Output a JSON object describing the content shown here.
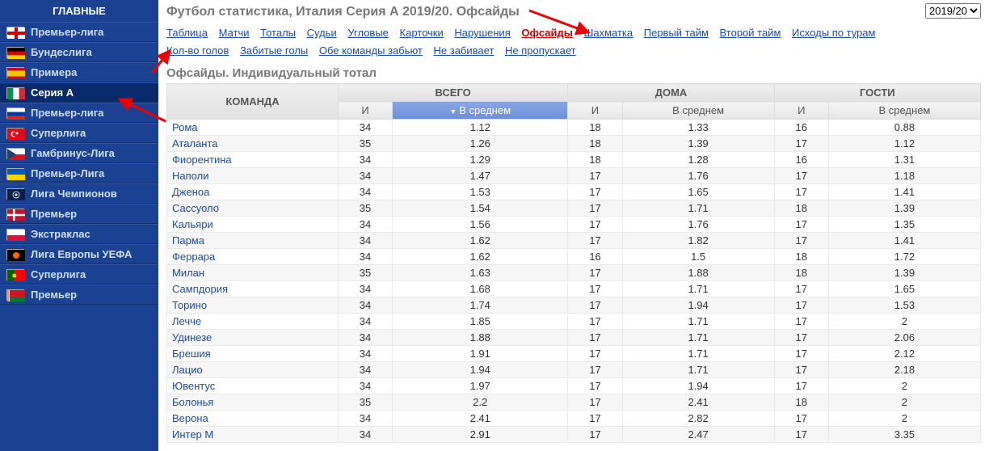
{
  "sidebar": {
    "header": "ГЛАВНЫЕ",
    "items": [
      {
        "label": "Премьер-лига",
        "flag": "england"
      },
      {
        "label": "Бундеслига",
        "flag": "germany"
      },
      {
        "label": "Примера",
        "flag": "spain"
      },
      {
        "label": "Серия А",
        "flag": "italy",
        "active": true
      },
      {
        "label": "Премьер-лига",
        "flag": "russia"
      },
      {
        "label": "Суперлига",
        "flag": "turkey"
      },
      {
        "label": "Гамбринус-Лига",
        "flag": "czech"
      },
      {
        "label": "Премьер-Лига",
        "flag": "ukraine"
      },
      {
        "label": "Лига Чемпионов",
        "flag": "uefa-cl"
      },
      {
        "label": "Премьер",
        "flag": "denmark"
      },
      {
        "label": "Экстраклас",
        "flag": "poland"
      },
      {
        "label": "Лига Европы УЕФА",
        "flag": "uefa-el"
      },
      {
        "label": "Суперлига",
        "flag": "portugal"
      },
      {
        "label": "Премьер",
        "flag": "belarus"
      }
    ]
  },
  "page_title": "Футбол статистика, Италия Серия А 2019/20. Офсайды",
  "season": "2019/20",
  "tabs_row1": [
    {
      "label": "Таблица"
    },
    {
      "label": "Матчи"
    },
    {
      "label": "Тоталы"
    },
    {
      "label": "Судьи"
    },
    {
      "label": "Угловые"
    },
    {
      "label": "Карточки"
    },
    {
      "label": "Нарушения"
    },
    {
      "label": "Офсайды",
      "active": true
    },
    {
      "label": "Шахматка"
    },
    {
      "label": "Первый тайм"
    },
    {
      "label": "Второй тайм"
    },
    {
      "label": "Исходы по турам"
    }
  ],
  "tabs_row2": [
    {
      "label": "Кол-во голов"
    },
    {
      "label": "Забитые голы"
    },
    {
      "label": "Обе команды забьют"
    },
    {
      "label": "Не забивает"
    },
    {
      "label": "Не пропускает"
    }
  ],
  "section_title": "Офсайды. Индивидуальный тотал",
  "table": {
    "group_headers": [
      "КОМАНДА",
      "ВСЕГО",
      "ДОМА",
      "ГОСТИ"
    ],
    "sub_headers": [
      "И",
      "В среднем",
      "И",
      "В среднем",
      "И",
      "В среднем"
    ],
    "sorted_col_label": "В среднем",
    "rows": [
      {
        "team": "Рома",
        "vals": [
          "34",
          "1.12",
          "18",
          "1.33",
          "16",
          "0.88"
        ]
      },
      {
        "team": "Аталанта",
        "vals": [
          "35",
          "1.26",
          "18",
          "1.39",
          "17",
          "1.12"
        ]
      },
      {
        "team": "Фиорентина",
        "vals": [
          "34",
          "1.29",
          "18",
          "1.28",
          "16",
          "1.31"
        ]
      },
      {
        "team": "Наполи",
        "vals": [
          "34",
          "1.47",
          "17",
          "1.76",
          "17",
          "1.18"
        ]
      },
      {
        "team": "Дженоа",
        "vals": [
          "34",
          "1.53",
          "17",
          "1.65",
          "17",
          "1.41"
        ]
      },
      {
        "team": "Сассуоло",
        "vals": [
          "35",
          "1.54",
          "17",
          "1.71",
          "18",
          "1.39"
        ]
      },
      {
        "team": "Кальяри",
        "vals": [
          "34",
          "1.56",
          "17",
          "1.76",
          "17",
          "1.35"
        ]
      },
      {
        "team": "Парма",
        "vals": [
          "34",
          "1.62",
          "17",
          "1.82",
          "17",
          "1.41"
        ]
      },
      {
        "team": "Феррара",
        "vals": [
          "34",
          "1.62",
          "16",
          "1.5",
          "18",
          "1.72"
        ]
      },
      {
        "team": "Милан",
        "vals": [
          "35",
          "1.63",
          "17",
          "1.88",
          "18",
          "1.39"
        ]
      },
      {
        "team": "Сампдория",
        "vals": [
          "34",
          "1.68",
          "17",
          "1.71",
          "17",
          "1.65"
        ]
      },
      {
        "team": "Торино",
        "vals": [
          "34",
          "1.74",
          "17",
          "1.94",
          "17",
          "1.53"
        ]
      },
      {
        "team": "Лечче",
        "vals": [
          "34",
          "1.85",
          "17",
          "1.71",
          "17",
          "2"
        ]
      },
      {
        "team": "Удинезе",
        "vals": [
          "34",
          "1.88",
          "17",
          "1.71",
          "17",
          "2.06"
        ]
      },
      {
        "team": "Брешия",
        "vals": [
          "34",
          "1.91",
          "17",
          "1.71",
          "17",
          "2.12"
        ]
      },
      {
        "team": "Лацио",
        "vals": [
          "34",
          "1.94",
          "17",
          "1.71",
          "17",
          "2.18"
        ]
      },
      {
        "team": "Ювентус",
        "vals": [
          "34",
          "1.97",
          "17",
          "1.94",
          "17",
          "2"
        ]
      },
      {
        "team": "Болонья",
        "vals": [
          "35",
          "2.2",
          "17",
          "2.41",
          "18",
          "2"
        ]
      },
      {
        "team": "Верона",
        "vals": [
          "34",
          "2.41",
          "17",
          "2.82",
          "17",
          "2"
        ]
      },
      {
        "team": "Интер М",
        "vals": [
          "34",
          "2.91",
          "17",
          "2.47",
          "17",
          "3.35"
        ]
      }
    ]
  },
  "flags": {
    "england": {
      "bg": "#fff",
      "svg": "<rect width='22' height='14' fill='white'/><rect x='9' width='4' height='14' fill='#c00'/><rect y='5' width='22' height='4' fill='#c00'/>"
    },
    "germany": {
      "bg": "#000",
      "svg": "<rect width='22' height='4.67' fill='#000'/><rect y='4.67' width='22' height='4.67' fill='#d00'/><rect y='9.33' width='22' height='4.67' fill='#fc0'/>"
    },
    "spain": {
      "bg": "#c00",
      "svg": "<rect width='22' height='14' fill='#c60b1e'/><rect y='3.5' width='22' height='7' fill='#ffc400'/>"
    },
    "italy": {
      "bg": "#fff",
      "svg": "<rect width='7.33' height='14' fill='#009246'/><rect x='7.33' width='7.33' height='14' fill='#fff'/><rect x='14.67' width='7.33' height='14' fill='#ce2b37'/>"
    },
    "russia": {
      "bg": "#fff",
      "svg": "<rect width='22' height='4.67' fill='#fff'/><rect y='4.67' width='22' height='4.67' fill='#0039a6'/><rect y='9.33' width='22' height='4.67' fill='#d52b1e'/>"
    },
    "turkey": {
      "bg": "#e30a17",
      "svg": "<rect width='22' height='14' fill='#e30a17'/><circle cx='8' cy='7' r='3.5' fill='#fff'/><circle cx='9' cy='7' r='2.8' fill='#e30a17'/><polygon points='12,7 13.5,7.5 13,6 14,5 12.5,5 12,3.5 11.5,5 10,5 11,6 10.5,7.5' fill='#fff'/>"
    },
    "czech": {
      "bg": "#fff",
      "svg": "<rect width='22' height='7' fill='#fff'/><rect y='7' width='22' height='7' fill='#d7141a'/><polygon points='0,0 11,7 0,14' fill='#11457e'/>"
    },
    "ukraine": {
      "bg": "#005bbb",
      "svg": "<rect width='22' height='7' fill='#005bbb'/><rect y='7' width='22' height='7' fill='#ffd500'/>"
    },
    "uefa-cl": {
      "bg": "#0a1f4d",
      "svg": "<rect width='22' height='14' fill='#0a1f4d'/><circle cx='11' cy='7' r='4' fill='none' stroke='#fff' stroke-width='0.8'/><circle cx='11' cy='7' r='1.5' fill='#fff'/>"
    },
    "denmark": {
      "bg": "#c8102e",
      "svg": "<rect width='22' height='14' fill='#c8102e'/><rect x='7' width='2.5' height='14' fill='#fff'/><rect y='5.75' width='22' height='2.5' fill='#fff'/>"
    },
    "poland": {
      "bg": "#fff",
      "svg": "<rect width='22' height='7' fill='#fff'/><rect y='7' width='22' height='7' fill='#dc143c'/>"
    },
    "uefa-el": {
      "bg": "#000",
      "svg": "<rect width='22' height='14' fill='#000'/><circle cx='11' cy='7' r='4' fill='#f60'/>"
    },
    "portugal": {
      "bg": "#060",
      "svg": "<rect width='8.8' height='14' fill='#006600'/><rect x='8.8' width='13.2' height='14' fill='#ff0000'/><circle cx='8.8' cy='7' r='2.8' fill='#ffcc00' stroke='#000' stroke-width='0.3'/>"
    },
    "belarus": {
      "bg": "#c00",
      "svg": "<rect width='22' height='9.33' fill='#ce1720'/><rect y='9.33' width='22' height='4.67' fill='#007c30'/><rect width='3' height='14' fill='#fff'/><rect x='0.5' width='0.5' height='14' fill='#ce1720'/><rect x='1.5' width='0.5' height='14' fill='#ce1720'/>"
    }
  }
}
